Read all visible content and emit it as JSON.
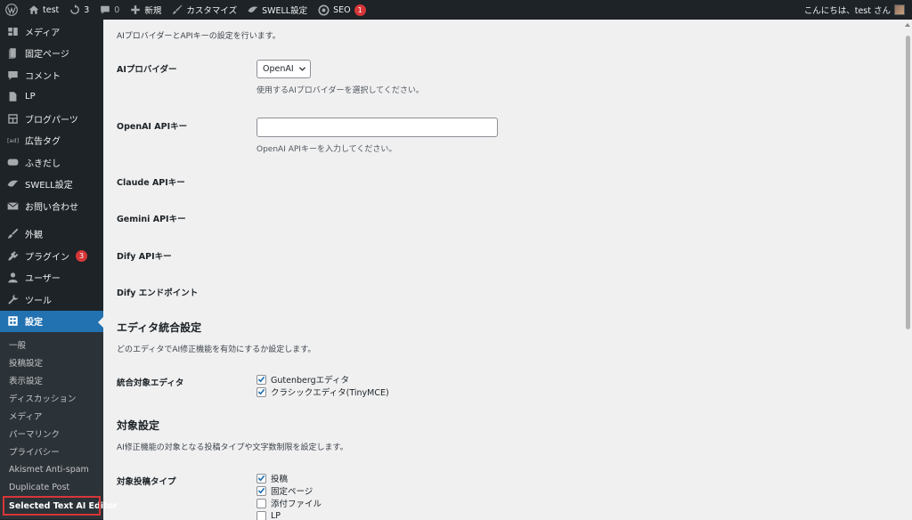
{
  "adminbar": {
    "site_name": "test",
    "updates_count": "3",
    "comments_count": "0",
    "new_label": "新規",
    "customize_label": "カスタマイズ",
    "swell_label": "SWELL設定",
    "seo_label": "SEO",
    "seo_badge": "1",
    "greeting": "こんにちは、test さん"
  },
  "sidebar": {
    "items": [
      {
        "label": "メディア",
        "icon": "media-icon"
      },
      {
        "label": "固定ページ",
        "icon": "page-icon"
      },
      {
        "label": "コメント",
        "icon": "comment-icon"
      },
      {
        "label": "LP",
        "icon": "lp-icon"
      },
      {
        "label": "ブログパーツ",
        "icon": "blog-parts-icon"
      },
      {
        "label": "広告タグ",
        "icon": "ad-tag-icon"
      },
      {
        "label": "ふきだし",
        "icon": "balloon-icon"
      },
      {
        "label": "SWELL設定",
        "icon": "swell-icon"
      },
      {
        "label": "お問い合わせ",
        "icon": "mail-icon"
      },
      {
        "label": "外観",
        "icon": "appearance-icon"
      },
      {
        "label": "プラグイン",
        "icon": "plugin-icon",
        "badge": "3"
      },
      {
        "label": "ユーザー",
        "icon": "user-icon"
      },
      {
        "label": "ツール",
        "icon": "tool-icon"
      },
      {
        "label": "設定",
        "icon": "settings-icon"
      }
    ],
    "submenu": [
      "一般",
      "投稿設定",
      "表示設定",
      "ディスカッション",
      "メディア",
      "パーマリンク",
      "プライバシー",
      "Akismet Anti-spam",
      "Duplicate Post",
      "Selected Text AI Editor"
    ]
  },
  "main": {
    "intro": "AIプロバイダーとAPIキーの設定を行います。",
    "provider": {
      "label": "AIプロバイダー",
      "selected": "OpenAI",
      "desc": "使用するAIプロバイダーを選択してください。"
    },
    "openai_key": {
      "label": "OpenAI APIキー",
      "value": "",
      "desc": "OpenAI APIキーを入力してください。"
    },
    "claude_key_label": "Claude APIキー",
    "gemini_key_label": "Gemini APIキー",
    "dify_key_label": "Dify APIキー",
    "dify_endpoint_label": "Dify エンドポイント",
    "editor_section": {
      "title": "エディタ統合設定",
      "desc": "どのエディタでAI修正機能を有効にするか設定します。",
      "row_label": "統合対象エディタ",
      "options": [
        {
          "label": "Gutenbergエディタ",
          "checked": true
        },
        {
          "label": "クラシックエディタ(TinyMCE)",
          "checked": true
        }
      ]
    },
    "target_section": {
      "title": "対象設定",
      "desc": "AI修正機能の対象となる投稿タイプや文字数制限を設定します。",
      "row_label": "対象投稿タイプ",
      "options": [
        {
          "label": "投稿",
          "checked": true
        },
        {
          "label": "固定ページ",
          "checked": true
        },
        {
          "label": "添付ファイル",
          "checked": false
        },
        {
          "label": "LP",
          "checked": false
        }
      ]
    }
  }
}
